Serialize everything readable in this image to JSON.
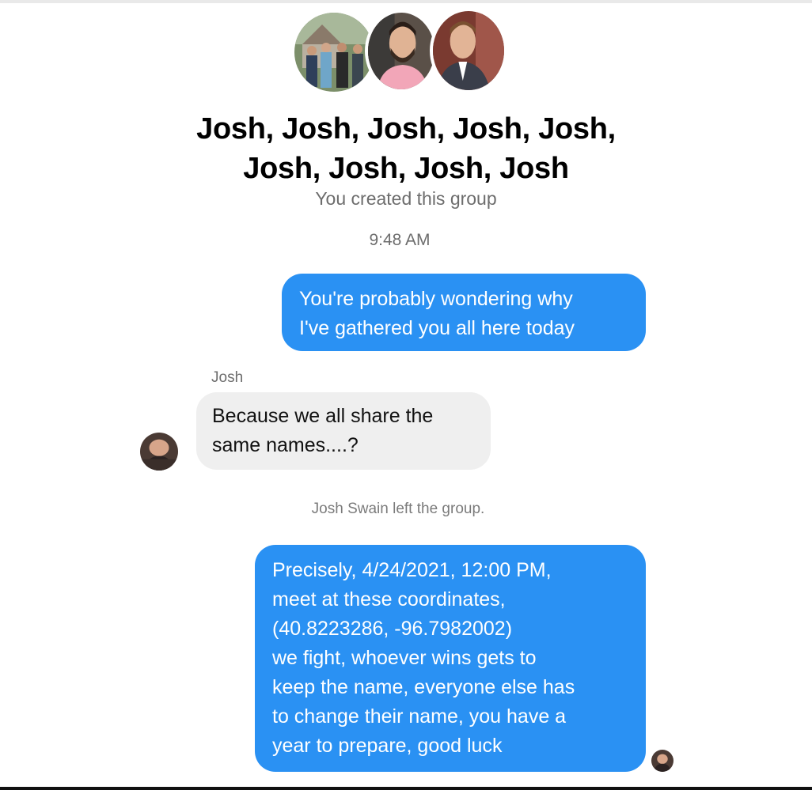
{
  "header": {
    "avatars": [
      {
        "name": "group-photo-avatar",
        "icon": "group-photo"
      },
      {
        "name": "man-pink-shirt-avatar",
        "icon": "person-photo"
      },
      {
        "name": "man-suit-avatar",
        "icon": "person-photo"
      }
    ],
    "title_line1": "Josh, Josh, Josh, Josh, Josh,",
    "title_line2": "Josh, Josh, Josh, Josh",
    "subtitle": "You created this group"
  },
  "conversation": {
    "timestamp": "9:48 AM",
    "messages": [
      {
        "direction": "outgoing",
        "lines": [
          "You're probably wondering why",
          "I've gathered you all here today"
        ]
      },
      {
        "direction": "incoming",
        "sender": "Josh",
        "lines": [
          "Because we all share the",
          "same names....?"
        ]
      },
      {
        "direction": "outgoing",
        "lines": [
          "Precisely, 4/24/2021, 12:00 PM,",
          "meet at these coordinates,",
          "(40.8223286, -96.7982002)",
          "we fight, whoever wins gets to",
          "keep the name, everyone else has",
          "to change their name, you have a",
          "year to prepare, good luck"
        ]
      }
    ],
    "system_note": "Josh Swain left the group."
  },
  "colors": {
    "outgoing_bubble": "#2a91f3",
    "incoming_bubble": "#efefef",
    "meta_text": "#6d6d6d"
  }
}
